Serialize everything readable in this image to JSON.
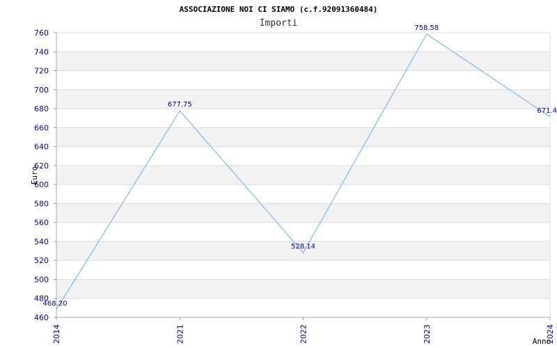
{
  "chart_data": {
    "type": "line",
    "title": "ASSOCIAZIONE NOI CI SIAMO (c.f.92091360484)",
    "subtitle": "Importi",
    "xlabel": "Anno",
    "ylabel": "Euro",
    "ylim": [
      460,
      760
    ],
    "ytick_step": 20,
    "grid": true,
    "categories": [
      "2014",
      "2021",
      "2022",
      "2023",
      "2024"
    ],
    "values": [
      468.2,
      677.75,
      528.14,
      758.58,
      671.4
    ],
    "data_labels": [
      "468.20",
      "677.75",
      "528.14",
      "758.58",
      "671.4"
    ],
    "line_color": "#6aaef0",
    "band_color": "#f2f2f2",
    "tick_color": "#0000a0"
  }
}
